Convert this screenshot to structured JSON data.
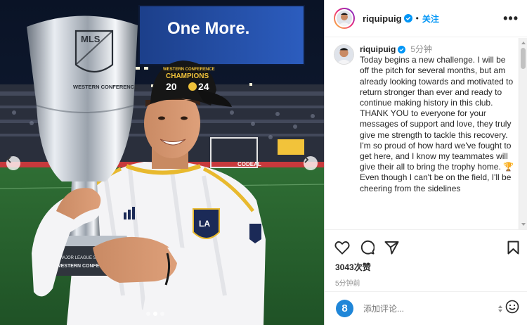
{
  "photo": {
    "stadium_screen_text": "One More.",
    "trophy_text": {
      "logo": "MLS",
      "conference": "WESTERN CONFERENCE",
      "base_line1": "MAJOR LEAGUE SOC",
      "base_line2": "WESTERN CONFEREN"
    },
    "cap_text": {
      "line1": "WESTERN CONFERENCE",
      "line2": "CHAMPIONS",
      "year_left": "20",
      "year_right": "24"
    },
    "crest_text": "LA",
    "board_text": "CODEAL",
    "slide_count": 3,
    "active_slide": 1
  },
  "header": {
    "username": "riquipuig",
    "separator": "•",
    "follow_label": "关注",
    "more_label": "•••"
  },
  "caption": {
    "username": "riquipuig",
    "time": "5分钟",
    "paragraphs": [
      "Today begins a new challenge. I will be off the pitch for several months, but am already looking towards and motivated to return stronger than ever and ready to continue making history in this club.",
      "THANK YOU to everyone for your messages of support and love, they truly give me strength to tackle this recovery.",
      "I'm so proud of how hard we've fought to get here, and I know my teammates will give their all to bring the trophy home. 🏆",
      "Even though I can't be on the field, I'll be cheering from the sidelines"
    ]
  },
  "engagement": {
    "likes": "3043次赞",
    "posted": "5分钟前"
  },
  "comment": {
    "placeholder": "添加评论...",
    "logo_letter": "8"
  },
  "colors": {
    "accent": "#0095f6",
    "verified": "#0095f6",
    "galaxy_gold": "#f0c23a",
    "galaxy_navy": "#1b2a57"
  }
}
